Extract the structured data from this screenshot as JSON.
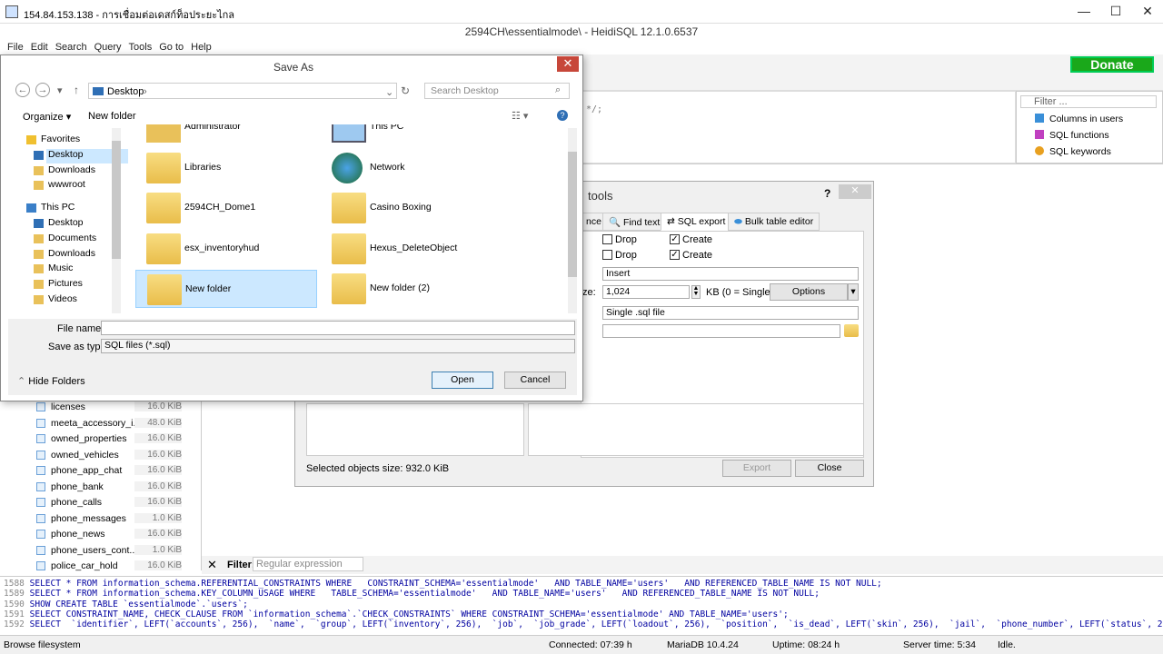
{
  "rdp": {
    "title": "154.84.153.138 - การเชื่อมต่อเดสก์ท็อประยะไกล"
  },
  "app": {
    "title": "2594CH\\essentialmode\\ - HeidiSQL 12.1.0.6537",
    "donate": "Donate"
  },
  "menu": [
    "File",
    "Edit",
    "Search",
    "Query",
    "Tools",
    "Go to",
    "Help"
  ],
  "editor": {
    "text": "*/;"
  },
  "helper": {
    "filter_placeholder": "Filter ...",
    "items": [
      "Columns in users",
      "SQL functions",
      "SQL keywords"
    ]
  },
  "tree": {
    "rows": [
      {
        "name": "licenses",
        "size": "16.0 KiB"
      },
      {
        "name": "meeta_accessory_i...",
        "size": "48.0 KiB"
      },
      {
        "name": "owned_properties",
        "size": "16.0 KiB"
      },
      {
        "name": "owned_vehicles",
        "size": "16.0 KiB"
      },
      {
        "name": "phone_app_chat",
        "size": "16.0 KiB"
      },
      {
        "name": "phone_bank",
        "size": "16.0 KiB"
      },
      {
        "name": "phone_calls",
        "size": "16.0 KiB"
      },
      {
        "name": "phone_messages",
        "size": "1.0 KiB"
      },
      {
        "name": "phone_news",
        "size": "16.0 KiB"
      },
      {
        "name": "phone_users_cont...",
        "size": "1.0 KiB"
      },
      {
        "name": "police_car_hold",
        "size": "16.0 KiB"
      }
    ]
  },
  "filterbar": {
    "label": "Filter:",
    "placeholder": "Regular expression"
  },
  "sqllog": [
    {
      "n": "1588",
      "t": "SELECT * FROM information_schema.REFERENTIAL_CONSTRAINTS WHERE   CONSTRAINT_SCHEMA='essentialmode'   AND TABLE_NAME='users'   AND REFERENCED_TABLE_NAME IS NOT NULL;"
    },
    {
      "n": "1589",
      "t": "SELECT * FROM information_schema.KEY_COLUMN_USAGE WHERE   TABLE_SCHEMA='essentialmode'   AND TABLE_NAME='users'   AND REFERENCED_TABLE_NAME IS NOT NULL;"
    },
    {
      "n": "1590",
      "t": "SHOW CREATE TABLE `essentialmode`.`users`;"
    },
    {
      "n": "1591",
      "t": "SELECT CONSTRAINT_NAME, CHECK_CLAUSE FROM `information_schema`.`CHECK_CONSTRAINTS` WHERE CONSTRAINT_SCHEMA='essentialmode' AND TABLE_NAME='users';"
    },
    {
      "n": "1592",
      "t": "SELECT  `identifier`, LEFT(`accounts`, 256),  `name`,  `group`, LEFT(`inventory`, 256),  `job`,  `job_grade`, LEFT(`loadout`, 256),  `position`,  `is_dead`, LEFT(`skin`, 256),  `jail`,  `phone_number`, LEFT(`status`, 25"
    }
  ],
  "status": {
    "left": "Browse filesystem",
    "connected": "Connected: 07:39 h",
    "server": "MariaDB 10.4.24",
    "uptime": "Uptime: 08:24 h",
    "time": "Server time: 5:34",
    "idle": "Idle."
  },
  "export": {
    "title": "tools",
    "help": "?",
    "tabs": [
      "nce",
      "Find text",
      "SQL export",
      "Bulk table editor"
    ],
    "drop1": "Drop",
    "create1": "Create",
    "drop2": "Drop",
    "create2": "Create",
    "data_mode": "Insert",
    "size_label": "ze:",
    "size_value": "1,024",
    "kb_label": "KB (0 = Single IN",
    "options": "Options",
    "output": "Single .sql file",
    "selected_size": "Selected objects size: 932.0 KiB",
    "export_btn": "Export",
    "close_btn": "Close"
  },
  "save": {
    "title": "Save As",
    "close": "✕",
    "path": "Desktop",
    "search_placeholder": "Search Desktop",
    "organize": "Organize",
    "new_folder": "New folder",
    "nav": [
      {
        "label": "Favorites",
        "group": true
      },
      {
        "label": "Desktop",
        "sel": true
      },
      {
        "label": "Downloads"
      },
      {
        "label": "wwwroot"
      },
      {
        "label": "This PC",
        "group": true
      },
      {
        "label": "Desktop"
      },
      {
        "label": "Documents"
      },
      {
        "label": "Downloads"
      },
      {
        "label": "Music"
      },
      {
        "label": "Pictures"
      },
      {
        "label": "Videos"
      }
    ],
    "files": [
      {
        "name": "Administrator",
        "icon": "user-icon"
      },
      {
        "name": "This PC",
        "icon": "computer-icon"
      },
      {
        "name": "Libraries",
        "icon": "library-icon"
      },
      {
        "name": "Network",
        "icon": "network-icon"
      },
      {
        "name": "2594CH_Dome1",
        "icon": "folder-icon"
      },
      {
        "name": "Casino Boxing",
        "icon": "folder-icon"
      },
      {
        "name": "esx_inventoryhud",
        "icon": "folder-icon"
      },
      {
        "name": "Hexus_DeleteObject",
        "icon": "folder-icon"
      },
      {
        "name": "New folder",
        "icon": "folder-icon",
        "sel": true
      },
      {
        "name": "New folder (2)",
        "icon": "folder-icon"
      }
    ],
    "file_name_label": "File name:",
    "file_name_value": "",
    "type_label": "Save as type:",
    "type_value": "SQL files (*.sql)",
    "hide_folders": "Hide Folders",
    "open": "Open",
    "cancel": "Cancel"
  }
}
